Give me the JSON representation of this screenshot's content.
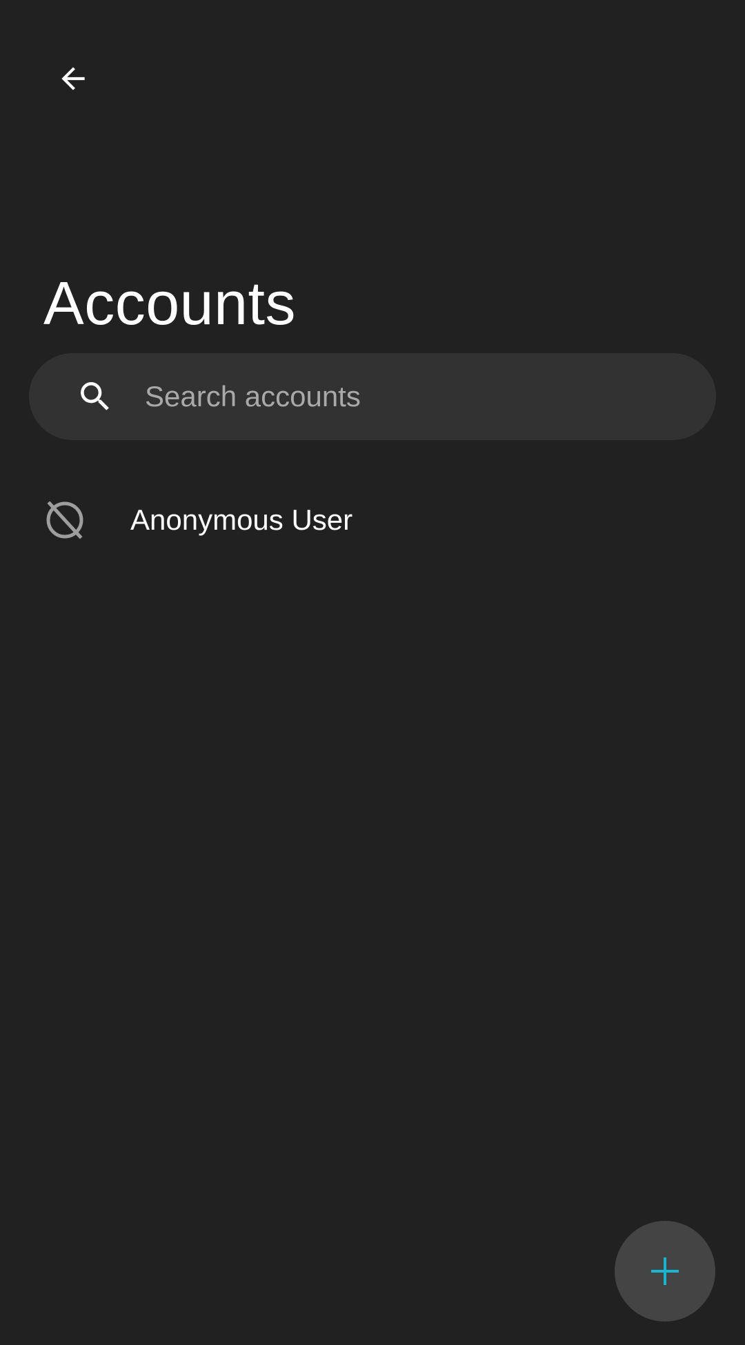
{
  "header": {
    "back_icon": "arrow-left-icon",
    "title": "Accounts"
  },
  "search": {
    "icon": "search-icon",
    "placeholder": "Search accounts",
    "value": ""
  },
  "accounts": [
    {
      "icon": "anonymous-avatar-icon",
      "name": "Anonymous User"
    }
  ],
  "fab": {
    "icon": "plus-icon",
    "accent_color": "#19b5d1"
  },
  "colors": {
    "background": "#212121",
    "search_background": "#323232",
    "fab_background": "#444444",
    "text_primary": "#ffffff",
    "text_hint": "#a9a9a9",
    "icon_muted": "#9e9e9e"
  }
}
